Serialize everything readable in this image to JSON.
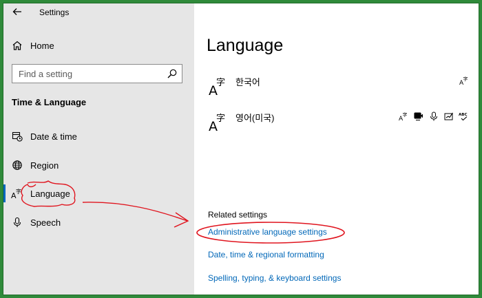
{
  "window": {
    "title": "Settings"
  },
  "sidebar": {
    "home_label": "Home",
    "search_placeholder": "Find a setting",
    "section_title": "Time & Language",
    "items": [
      {
        "label": "Date & time",
        "icon": "calendar-clock-icon"
      },
      {
        "label": "Region",
        "icon": "globe-icon"
      },
      {
        "label": "Language",
        "icon": "language-icon",
        "active": true
      },
      {
        "label": "Speech",
        "icon": "microphone-icon"
      }
    ]
  },
  "main": {
    "title": "Language",
    "languages": [
      {
        "name": "한국어",
        "features": [
          "language-options-icon"
        ]
      },
      {
        "name": "영어(미국)",
        "features": [
          "language-options-icon",
          "text-to-speech-icon",
          "speech-recognition-icon",
          "handwriting-icon",
          "spell-check-icon"
        ]
      }
    ],
    "related": {
      "heading": "Related settings",
      "links": [
        "Administrative language settings",
        "Date, time & regional formatting",
        "Spelling, typing, & keyboard settings"
      ]
    }
  },
  "colors": {
    "accent": "#0067c0",
    "link": "#0067b8",
    "sidebar_bg": "#e6e6e6",
    "annotation": "#e0141e",
    "frame": "#2f8a3a"
  }
}
